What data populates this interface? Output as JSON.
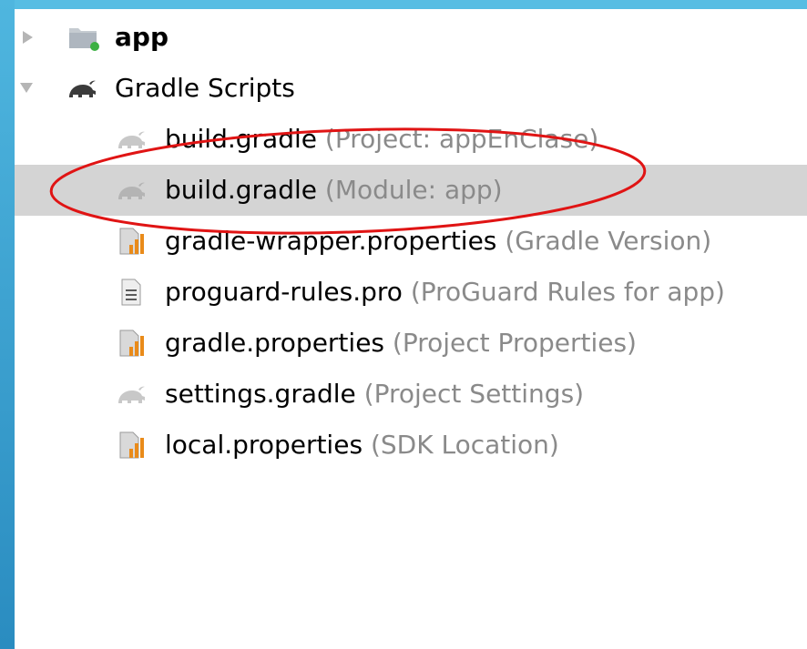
{
  "tree": {
    "app": {
      "name": "app",
      "icon": "module-folder-icon"
    },
    "gradle_scripts": {
      "name": "Gradle Scripts",
      "icon": "gradle-elephant-icon"
    },
    "files": [
      {
        "name": "build.gradle",
        "hint": "(Project: appEnClase)",
        "icon": "gradle-elephant-icon",
        "selected": false
      },
      {
        "name": "build.gradle",
        "hint": "(Module: app)",
        "icon": "gradle-elephant-icon",
        "selected": true
      },
      {
        "name": "gradle-wrapper.properties",
        "hint": "(Gradle Version)",
        "icon": "properties-file-icon",
        "selected": false
      },
      {
        "name": "proguard-rules.pro",
        "hint": "(ProGuard Rules for app)",
        "icon": "text-file-icon",
        "selected": false
      },
      {
        "name": "gradle.properties",
        "hint": "(Project Properties)",
        "icon": "properties-file-icon",
        "selected": false
      },
      {
        "name": "settings.gradle",
        "hint": "(Project Settings)",
        "icon": "gradle-elephant-icon",
        "selected": false
      },
      {
        "name": "local.properties",
        "hint": "(SDK Location)",
        "icon": "properties-file-icon",
        "selected": false
      }
    ]
  },
  "colors": {
    "selection": "#d4d4d4",
    "hint_text": "#8a8a8a",
    "annotation": "#e01414",
    "frame": "#3aa0cf"
  }
}
